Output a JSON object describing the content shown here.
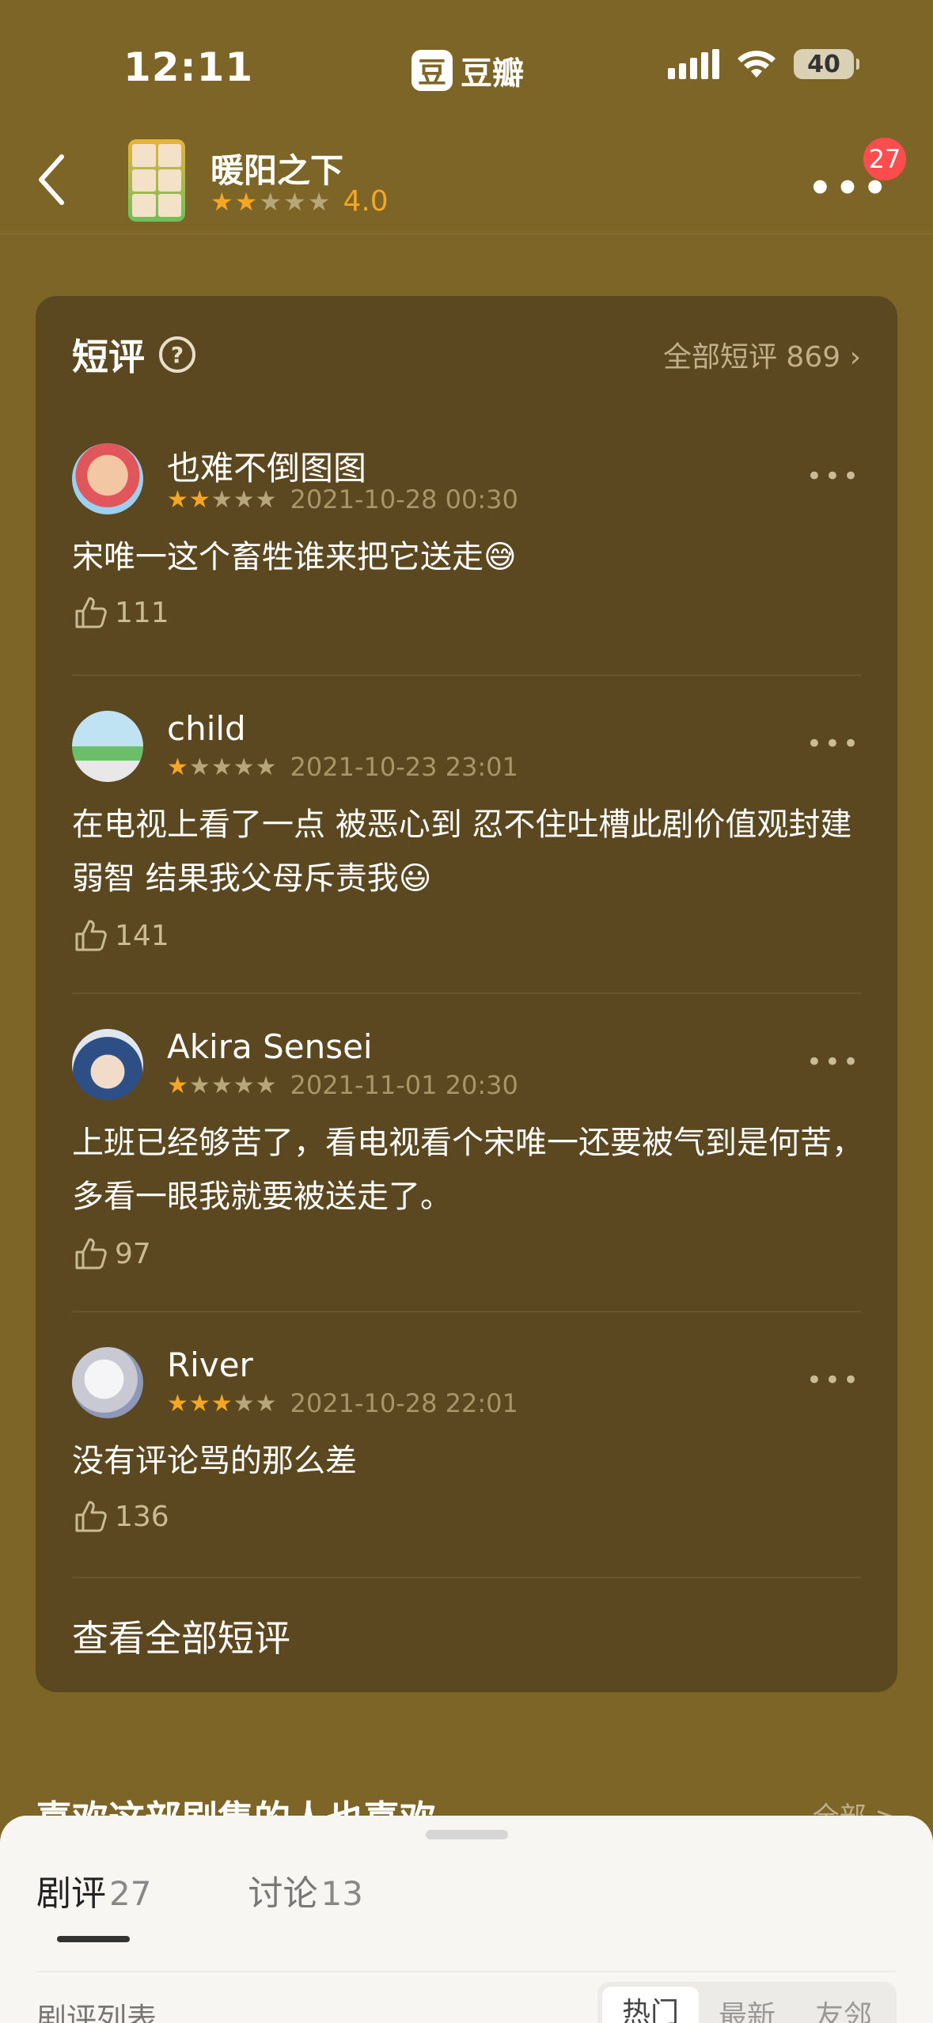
{
  "status": {
    "time": "12:11",
    "app_name": "豆瓣",
    "app_logo": "豆",
    "battery": "40"
  },
  "header": {
    "back_icon": "chevron-left-icon",
    "title": "暖阳之下",
    "rating_stars": 2,
    "rating_value": "4.0",
    "more_icon": "ellipsis-icon",
    "notification_count": "27"
  },
  "short_reviews": {
    "title": "短评",
    "help_icon": "?",
    "all_link": "全部短评 869",
    "view_all": "查看全部短评",
    "items": [
      {
        "user": "也难不倒图图",
        "stars": 2,
        "date": "2021-10-28 00:30",
        "text": "宋唯一这个畜牲谁来把它送走😅",
        "likes": "111"
      },
      {
        "user": "child",
        "stars": 1,
        "date": "2021-10-23 23:01",
        "text": "在电视上看了一点 被恶心到 忍不住吐槽此剧价值观封建弱智 结果我父母斥责我😃",
        "likes": "141"
      },
      {
        "user": "Akira Sensei",
        "stars": 1,
        "date": "2021-11-01 20:30",
        "text": "上班已经够苦了，看电视看个宋唯一还要被气到是何苦，多看一眼我就要被送走了。",
        "likes": "97"
      },
      {
        "user": "River",
        "stars": 3,
        "date": "2021-10-28 22:01",
        "text": "没有评论骂的那么差",
        "likes": "136"
      }
    ]
  },
  "next_section": {
    "title": "喜欢这部剧集的人也喜欢",
    "all": "全部 >"
  },
  "sheet": {
    "tabs": [
      {
        "label": "剧评",
        "count": "27"
      },
      {
        "label": "讨论",
        "count": "13"
      }
    ],
    "list_label": "剧评列表",
    "sort_options": [
      "热门",
      "最新",
      "友邻"
    ]
  }
}
